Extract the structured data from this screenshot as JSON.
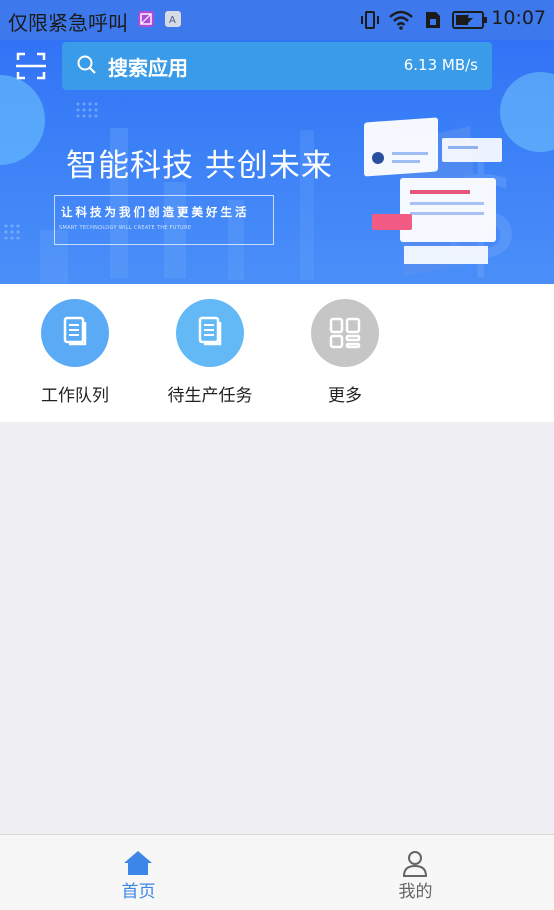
{
  "status_bar": {
    "carrier_text": "仅限紧急呼叫",
    "time": "10:07",
    "icons": [
      "vibrate-icon",
      "wifi-icon",
      "sim-icon",
      "battery-charging-icon"
    ]
  },
  "search": {
    "placeholder": "搜索应用",
    "speed": "6.13 MB/s"
  },
  "banner": {
    "title": "智能科技 共创未来",
    "subtitle": "让科技为我们创造更美好生活",
    "subtitle_en": "SMART TECHNOLOGY WILL CREATE THE FUTURE"
  },
  "quick_menu": [
    {
      "label": "工作队列",
      "icon": "document-icon",
      "color": "#5aaaf6"
    },
    {
      "label": "待生产任务",
      "icon": "document-icon",
      "color": "#63b8f6"
    },
    {
      "label": "更多",
      "icon": "grid-icon",
      "color": "#c6c6c6"
    }
  ],
  "tabs": [
    {
      "label": "首页",
      "icon": "home-icon",
      "active": true,
      "color": "#3b86e6"
    },
    {
      "label": "我的",
      "icon": "user-icon",
      "active": false,
      "color": "#666666"
    }
  ],
  "colors": {
    "accent": "#3b86e6",
    "header": "#3a7ef7",
    "background": "#efeff4"
  }
}
